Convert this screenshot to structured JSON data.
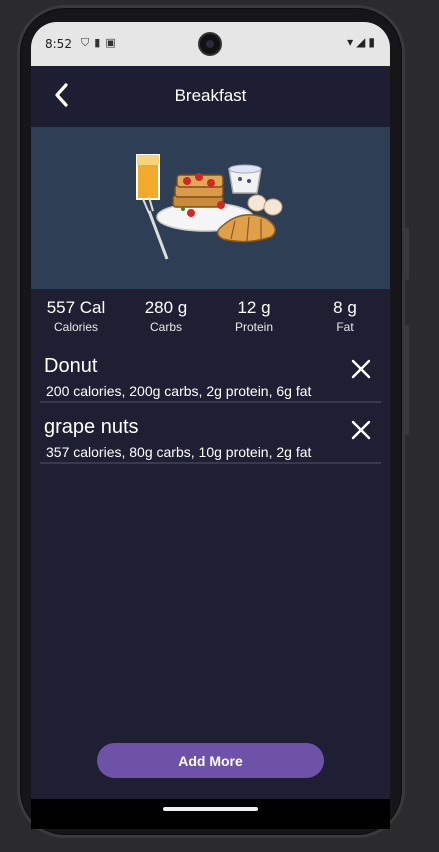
{
  "status_bar": {
    "time": "8:52",
    "left_icons": [
      "shield-icon",
      "clipboard-icon",
      "sim-icon"
    ],
    "right_icons": [
      "wifi-icon",
      "signal-icon",
      "battery-icon"
    ]
  },
  "header": {
    "title": "Breakfast",
    "back_icon": "chevron-left-icon"
  },
  "hero": {
    "image": "breakfast-illustration",
    "background": "#2e3f55"
  },
  "summary": [
    {
      "value": "557 Cal",
      "label": "Calories"
    },
    {
      "value": "280 g",
      "label": "Carbs"
    },
    {
      "value": "12 g",
      "label": "Protein"
    },
    {
      "value": "8 g",
      "label": "Fat"
    }
  ],
  "items": [
    {
      "name": "Donut",
      "details": "200 calories, 200g carbs, 2g protein, 6g fat",
      "remove_icon": "close-icon"
    },
    {
      "name": "grape nuts",
      "details": "357 calories, 80g carbs, 10g protein, 2g fat",
      "remove_icon": "close-icon"
    }
  ],
  "actions": {
    "add_more_label": "Add More"
  },
  "colors": {
    "screen_bg": "#1f1f33",
    "accent": "#6e52a8",
    "divider": "#38384e"
  }
}
